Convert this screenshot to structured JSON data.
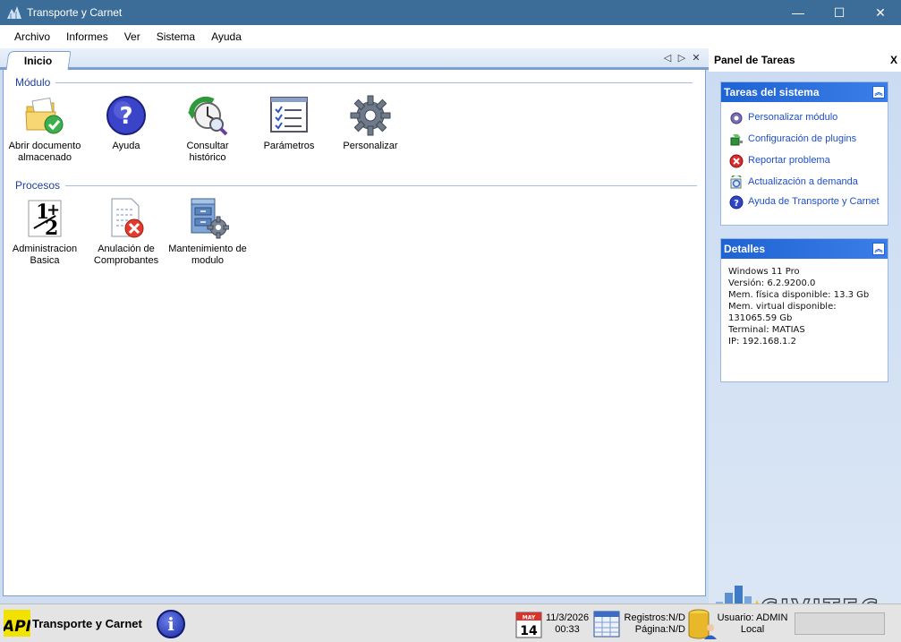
{
  "window": {
    "title": "Transporte y Carnet",
    "controls": {
      "minimize": "—",
      "maximize": "☐",
      "close": "✕"
    }
  },
  "menu": [
    "Archivo",
    "Informes",
    "Ver",
    "Sistema",
    "Ayuda"
  ],
  "tab": {
    "label": "Inicio",
    "nav_prev": "◁",
    "nav_next": "▷",
    "close": "✕"
  },
  "groups": {
    "modulo": {
      "label": "Módulo",
      "items": [
        {
          "label": "Abrir documento almacenado",
          "icon": "folder-check-icon"
        },
        {
          "label": "Ayuda",
          "icon": "help-icon"
        },
        {
          "label": "Consultar histórico",
          "icon": "history-clock-icon"
        },
        {
          "label": "Parámetros",
          "icon": "checklist-icon"
        },
        {
          "label": "Personalizar",
          "icon": "gear-icon"
        }
      ]
    },
    "procesos": {
      "label": "Procesos",
      "items": [
        {
          "label": "Administracion Basica",
          "icon": "math-icon"
        },
        {
          "label": "Anulación de Comprobantes",
          "icon": "document-cancel-icon"
        },
        {
          "label": "Mantenimiento de modulo",
          "icon": "cabinet-gear-icon"
        }
      ]
    }
  },
  "task_panel": {
    "title": "Panel de Tareas",
    "close": "X",
    "system_tasks": {
      "title": "Tareas del sistema",
      "items": [
        {
          "label": "Personalizar módulo",
          "icon": "gear-icon"
        },
        {
          "label": "Configuración de plugins",
          "icon": "plugin-icon"
        },
        {
          "label": "Reportar problema",
          "icon": "error-icon"
        },
        {
          "label": "Actualización a demanda",
          "icon": "update-icon"
        },
        {
          "label": "Ayuda de Transporte y Carnet",
          "icon": "help-icon"
        }
      ]
    },
    "details": {
      "title": "Detalles",
      "lines": [
        "Windows 11 Pro",
        "Versión: 6.2.9200.0",
        "Mem. física disponible: 13.3 Gb",
        "Mem. virtual disponible:",
        "131065.59 Gb",
        "Terminal: MATIAS",
        "IP: 192.168.1.2"
      ]
    },
    "logo_text": "CIVITEC"
  },
  "status": {
    "app_name": "Transporte y Carnet",
    "logo_text": "API",
    "info_glyph": "i",
    "calendar_month": "MAY",
    "calendar_day": "14",
    "date": "11/3/2026",
    "time": "00:33",
    "registros": "Registros:N/D",
    "pagina": "Página:N/D",
    "usuario": "Usuario: ADMIN",
    "location": "Local"
  },
  "colors": {
    "titlebar": "#3c6d98",
    "box_header": "#1e63d3",
    "link": "#1f4fc4",
    "group_label": "#1f3f9c"
  }
}
